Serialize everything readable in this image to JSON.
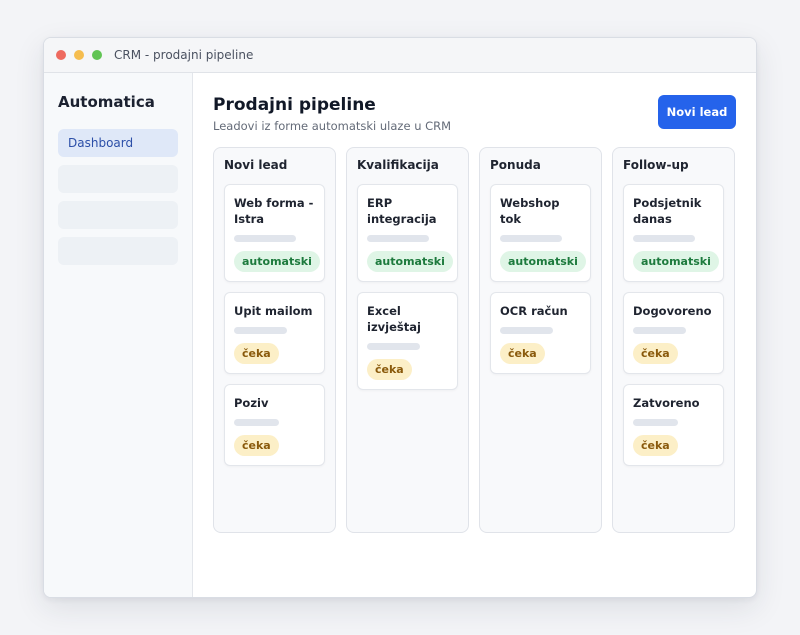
{
  "window": {
    "title": "CRM - prodajni pipeline"
  },
  "sidebar": {
    "brand": "Automatica",
    "items": [
      {
        "label": "Dashboard",
        "active": true
      },
      {
        "label": ""
      },
      {
        "label": ""
      },
      {
        "label": ""
      }
    ]
  },
  "header": {
    "title": "Prodajni pipeline",
    "subtitle": "Leadovi iz forme automatski ulaze u CRM",
    "new_lead_button": "Novi lead"
  },
  "columns": [
    {
      "title": "Novi lead",
      "cards": [
        {
          "title": "Web forma - Istra",
          "tag": "automatski",
          "tag_type": "auto"
        },
        {
          "title": "Upit mailom",
          "tag": "čeka",
          "tag_type": "wait"
        },
        {
          "title": "Poziv",
          "tag": "čeka",
          "tag_type": "wait"
        }
      ]
    },
    {
      "title": "Kvalifikacija",
      "cards": [
        {
          "title": "ERP integracija",
          "tag": "automatski",
          "tag_type": "auto"
        },
        {
          "title": "Excel izvještaj",
          "tag": "čeka",
          "tag_type": "wait"
        }
      ]
    },
    {
      "title": "Ponuda",
      "cards": [
        {
          "title": "Webshop tok",
          "tag": "automatski",
          "tag_type": "auto"
        },
        {
          "title": "OCR račun",
          "tag": "čeka",
          "tag_type": "wait"
        }
      ]
    },
    {
      "title": "Follow-up",
      "cards": [
        {
          "title": "Podsjetnik danas",
          "tag": "automatski",
          "tag_type": "auto"
        },
        {
          "title": "Dogovoreno",
          "tag": "čeka",
          "tag_type": "wait"
        },
        {
          "title": "Zatvoreno",
          "tag": "čeka",
          "tag_type": "wait"
        }
      ]
    }
  ],
  "colors": {
    "accent": "#2563eb",
    "tag_auto_bg": "#dff5e6",
    "tag_auto_text": "#1d7a3d",
    "tag_wait_bg": "#fcefc7",
    "tag_wait_text": "#8a5a0c"
  }
}
